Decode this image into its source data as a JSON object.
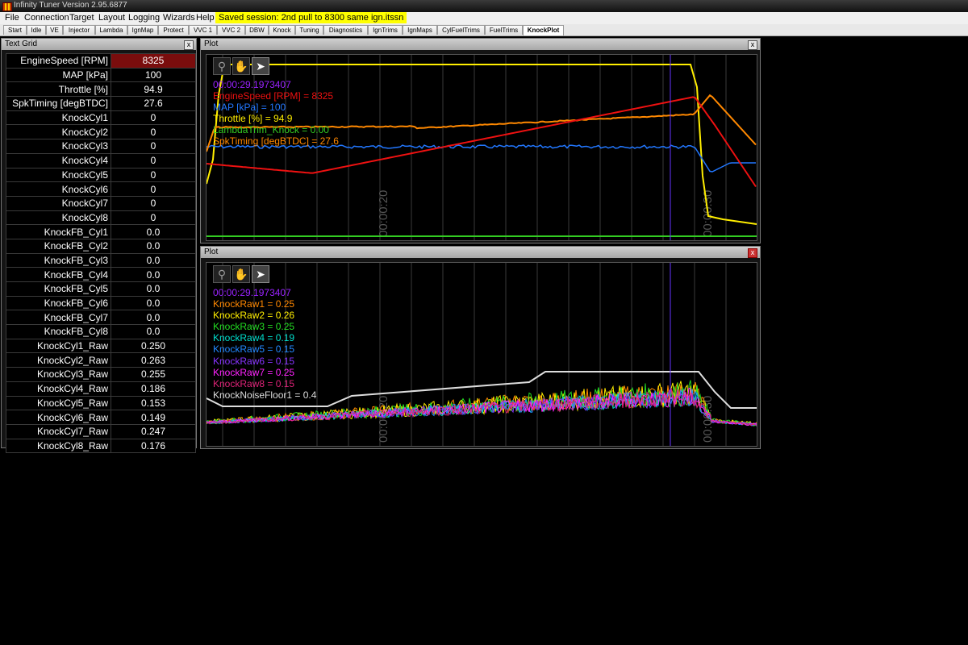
{
  "window": {
    "title": "Infinity Tuner Version 2.95.6877"
  },
  "menu": [
    "File",
    "Connection",
    "Target",
    "Layout",
    "Logging",
    "Wizards",
    "Help"
  ],
  "session": "Saved session: 2nd pull to 8300 same ign.itssn",
  "tabs": [
    "Start",
    "Idle",
    "VE",
    "Injector",
    "Lambda",
    "IgnMap",
    "Protect",
    "VVC 1",
    "VVC 2",
    "DBW",
    "Knock",
    "Tuning",
    "Diagnostics",
    "IgnTrims",
    "IgnMaps",
    "CylFuelTrims",
    "FuelTrims",
    "KnockPlot"
  ],
  "active_tab": "KnockPlot",
  "text_grid": {
    "title": "Text Grid",
    "close": "x",
    "rows": [
      {
        "label": "EngineSpeed [RPM]",
        "value": "8325"
      },
      {
        "label": "MAP [kPa]",
        "value": "100"
      },
      {
        "label": "Throttle [%]",
        "value": "94.9"
      },
      {
        "label": "SpkTiming [degBTDC]",
        "value": "27.6"
      },
      {
        "label": "KnockCyl1",
        "value": "0"
      },
      {
        "label": "KnockCyl2",
        "value": "0"
      },
      {
        "label": "KnockCyl3",
        "value": "0"
      },
      {
        "label": "KnockCyl4",
        "value": "0"
      },
      {
        "label": "KnockCyl5",
        "value": "0"
      },
      {
        "label": "KnockCyl6",
        "value": "0"
      },
      {
        "label": "KnockCyl7",
        "value": "0"
      },
      {
        "label": "KnockCyl8",
        "value": "0"
      },
      {
        "label": "KnockFB_Cyl1",
        "value": "0.0"
      },
      {
        "label": "KnockFB_Cyl2",
        "value": "0.0"
      },
      {
        "label": "KnockFB_Cyl3",
        "value": "0.0"
      },
      {
        "label": "KnockFB_Cyl4",
        "value": "0.0"
      },
      {
        "label": "KnockFB_Cyl5",
        "value": "0.0"
      },
      {
        "label": "KnockFB_Cyl6",
        "value": "0.0"
      },
      {
        "label": "KnockFB_Cyl7",
        "value": "0.0"
      },
      {
        "label": "KnockFB_Cyl8",
        "value": "0.0"
      },
      {
        "label": "KnockCyl1_Raw",
        "value": "0.250"
      },
      {
        "label": "KnockCyl2_Raw",
        "value": "0.263"
      },
      {
        "label": "KnockCyl3_Raw",
        "value": "0.255"
      },
      {
        "label": "KnockCyl4_Raw",
        "value": "0.186"
      },
      {
        "label": "KnockCyl5_Raw",
        "value": "0.153"
      },
      {
        "label": "KnockCyl6_Raw",
        "value": "0.149"
      },
      {
        "label": "KnockCyl7_Raw",
        "value": "0.247"
      },
      {
        "label": "KnockCyl8_Raw",
        "value": "0.176"
      }
    ]
  },
  "plot1": {
    "title": "Plot",
    "close": "x",
    "timestamp": "00:00:29.1973407",
    "legend": [
      {
        "text": "EngineSpeed [RPM] = 8325",
        "color": "#ee1111"
      },
      {
        "text": "MAP [kPa] = 100",
        "color": "#2277ff"
      },
      {
        "text": "Throttle [%] = 94.9",
        "color": "#ffee00"
      },
      {
        "text": "LambdaTrim_Knock = 0.00",
        "color": "#33cc22"
      },
      {
        "text": "SpkTiming [degBTDC] = 27.6",
        "color": "#ff8800"
      }
    ],
    "time_ticks": [
      "00:00:20",
      "00:00:30"
    ]
  },
  "plot2": {
    "title": "Plot",
    "close": "x",
    "timestamp": "00:00:29.1973407",
    "legend": [
      {
        "text": "KnockRaw1 = 0.25",
        "color": "#ff8800"
      },
      {
        "text": "KnockRaw2 = 0.26",
        "color": "#ffee00"
      },
      {
        "text": "KnockRaw3 = 0.25",
        "color": "#22dd22"
      },
      {
        "text": "KnockRaw4 = 0.19",
        "color": "#00ddcc"
      },
      {
        "text": "KnockRaw5 = 0.15",
        "color": "#2288ff"
      },
      {
        "text": "KnockRaw6 = 0.15",
        "color": "#8833ff"
      },
      {
        "text": "KnockRaw7 = 0.25",
        "color": "#ff22ff"
      },
      {
        "text": "KnockRaw8 = 0.15",
        "color": "#dd2277"
      },
      {
        "text": "KnockNoiseFloor1 = 0.4",
        "color": "#dddddd"
      }
    ],
    "time_ticks": [
      "00:00:20",
      "00:00:30"
    ]
  },
  "colors": {
    "timestamp": "#9922ff",
    "cursor": "#6633ff",
    "grid": "#3a3a3a"
  },
  "icons": [
    "magnifier-icon",
    "hand-pan-icon",
    "pointer-icon"
  ]
}
